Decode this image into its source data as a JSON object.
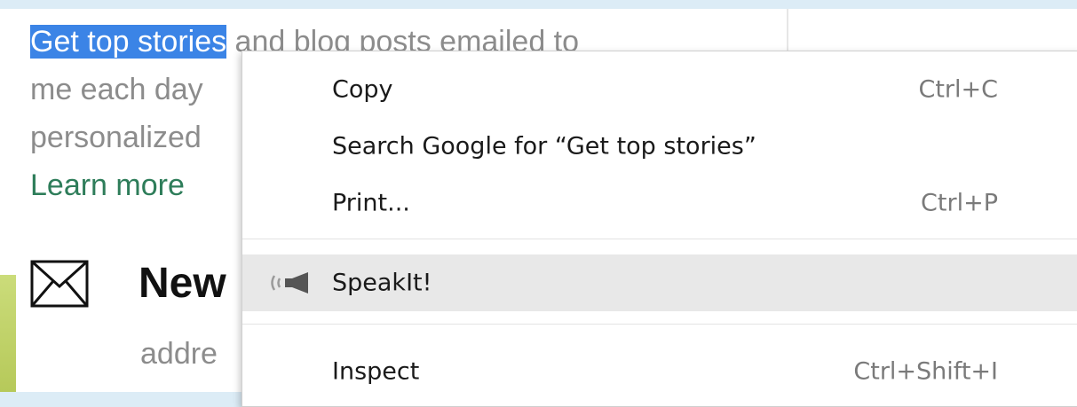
{
  "page": {
    "description_line1_selected": "Get top stories",
    "description_line1_rest": " and blog posts emailed to",
    "description_line2": "me each day",
    "description_line3": "personalized",
    "learn_more": "Learn more",
    "newsletter_title": "New",
    "address_text": "addre"
  },
  "context_menu": {
    "items": [
      {
        "label": "Copy",
        "shortcut": "Ctrl+C"
      },
      {
        "label": "Search Google for “Get top stories”",
        "shortcut": ""
      },
      {
        "label": "Print...",
        "shortcut": "Ctrl+P"
      },
      {
        "label": "SpeakIt!",
        "shortcut": "",
        "icon": "speaker-icon",
        "hovered": true
      },
      {
        "label": "Inspect",
        "shortcut": "Ctrl+Shift+I"
      }
    ]
  },
  "colors": {
    "selection": "#3b84e6",
    "link": "#2e7d5a",
    "hover": "#e8e8e8"
  }
}
